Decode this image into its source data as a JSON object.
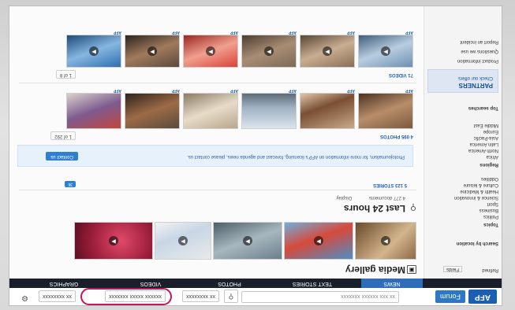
{
  "colors": {
    "accent": "#2f7fd0",
    "nav_bg": "#1b1f2b",
    "highlight_ring": "#c2185b"
  },
  "header": {
    "logo_text": "AFP",
    "forum_label": "Forum",
    "search_placeholder": "xx xxx xxxxxx xxxxxxx",
    "filters": [
      "xx xxxxxxxx",
      "xxxxxx xxxxx xxxxxxx",
      "xx xxxxxxxx"
    ]
  },
  "nav": {
    "tabs": [
      "NEWS",
      "TEXT STORIES",
      "PHOTOS",
      "VIDEOS",
      "GRAPHICS"
    ]
  },
  "sidebar": {
    "sections": [
      {
        "label": "Refined",
        "value": "Fields"
      },
      {
        "label": "Search by location"
      },
      {
        "label": "Topics"
      },
      {
        "label": "Regions"
      },
      {
        "label": "Top searches"
      }
    ],
    "regions": [
      "Africa",
      "North America",
      "Latin America",
      "Asia-Pacific",
      "Europe",
      "Middle East"
    ],
    "topics": [
      "Politics",
      "Business",
      "Sport",
      "Science & innovation",
      "Health & Medicine",
      "Culture & leisure",
      "Oddities"
    ],
    "partners_title": "PARTNERS",
    "partners_sub": "Check our offers",
    "links": [
      "Product information",
      "Questions we use",
      "Report an incident"
    ]
  },
  "main": {
    "gallery_title": "Media gallery",
    "section_title": "Last 24 hours",
    "stories_count": "4 277 documents",
    "stories_filter": "Display",
    "banner_text": "Photojournalism, for more information on AFP's licensing, forecast and agenda news, please contact us.",
    "banner_button": "Contact us",
    "photos_count": "4 095 PHOTOS",
    "photos_pager": "1 of 292",
    "videos_count": "71 VIDEOS",
    "videos_pager": "1 of 8",
    "stories_total": "5 123 STORIES",
    "badge_count": "36",
    "thumb_source": "AFP"
  }
}
